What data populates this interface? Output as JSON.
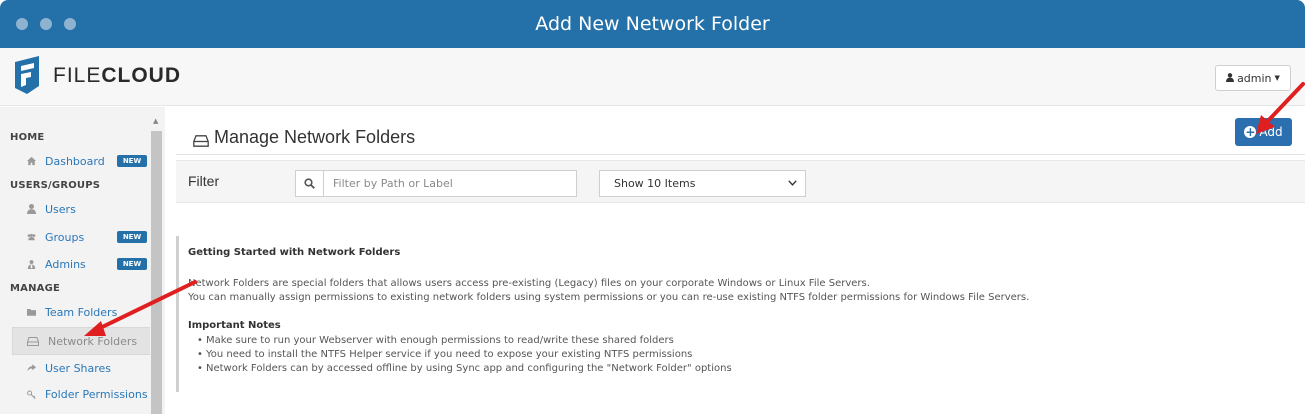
{
  "window": {
    "title": "Add New Network Folder"
  },
  "brand": {
    "name_light": "FILE",
    "name_bold": "CLOUD"
  },
  "header": {
    "user_label": "admin"
  },
  "sidebar": {
    "sections": [
      {
        "heading": "HOME",
        "items": [
          {
            "label": "Dashboard",
            "badge": "NEW",
            "icon": "home-icon"
          }
        ]
      },
      {
        "heading": "USERS/GROUPS",
        "items": [
          {
            "label": "Users",
            "badge": "",
            "icon": "user-icon"
          },
          {
            "label": "Groups",
            "badge": "NEW",
            "icon": "group-icon"
          },
          {
            "label": "Admins",
            "badge": "NEW",
            "icon": "admin-icon"
          }
        ]
      },
      {
        "heading": "MANAGE",
        "items": [
          {
            "label": "Team Folders",
            "badge": "",
            "icon": "folder-icon"
          },
          {
            "label": "Network Folders",
            "badge": "",
            "icon": "drive-icon",
            "active": true
          },
          {
            "label": "User Shares",
            "badge": "",
            "icon": "share-icon"
          },
          {
            "label": "Folder Permissions",
            "badge": "",
            "icon": "key-icon"
          }
        ]
      }
    ]
  },
  "main": {
    "title": "Manage Network Folders",
    "add_label": "Add",
    "filter": {
      "label": "Filter",
      "search_placeholder": "Filter by Path or Label",
      "page_size_selected": "Show 10 Items"
    },
    "info": {
      "title": "Getting Started with Network Folders",
      "lines": [
        "Network Folders are special folders that allows users access pre-existing (Legacy) files on your corporate Windows or Linux File Servers.",
        "You can manually assign permissions to existing network folders using system permissions or you can re-use existing NTFS folder permissions for Windows File Servers."
      ],
      "notes_title": "Important Notes",
      "notes": [
        "Make sure to run your Webserver with enough permissions to read/write these shared folders",
        "You need to install the NTFS Helper service if you need to expose your existing NTFS permissions",
        "Network Folders can by accessed offline by using Sync app and configuring the \"Network Folder\" options"
      ]
    }
  },
  "colors": {
    "titlebar": "#2470a8",
    "accent": "#2c6fb0",
    "arrow": "#e02020",
    "link": "#2a77b8"
  }
}
